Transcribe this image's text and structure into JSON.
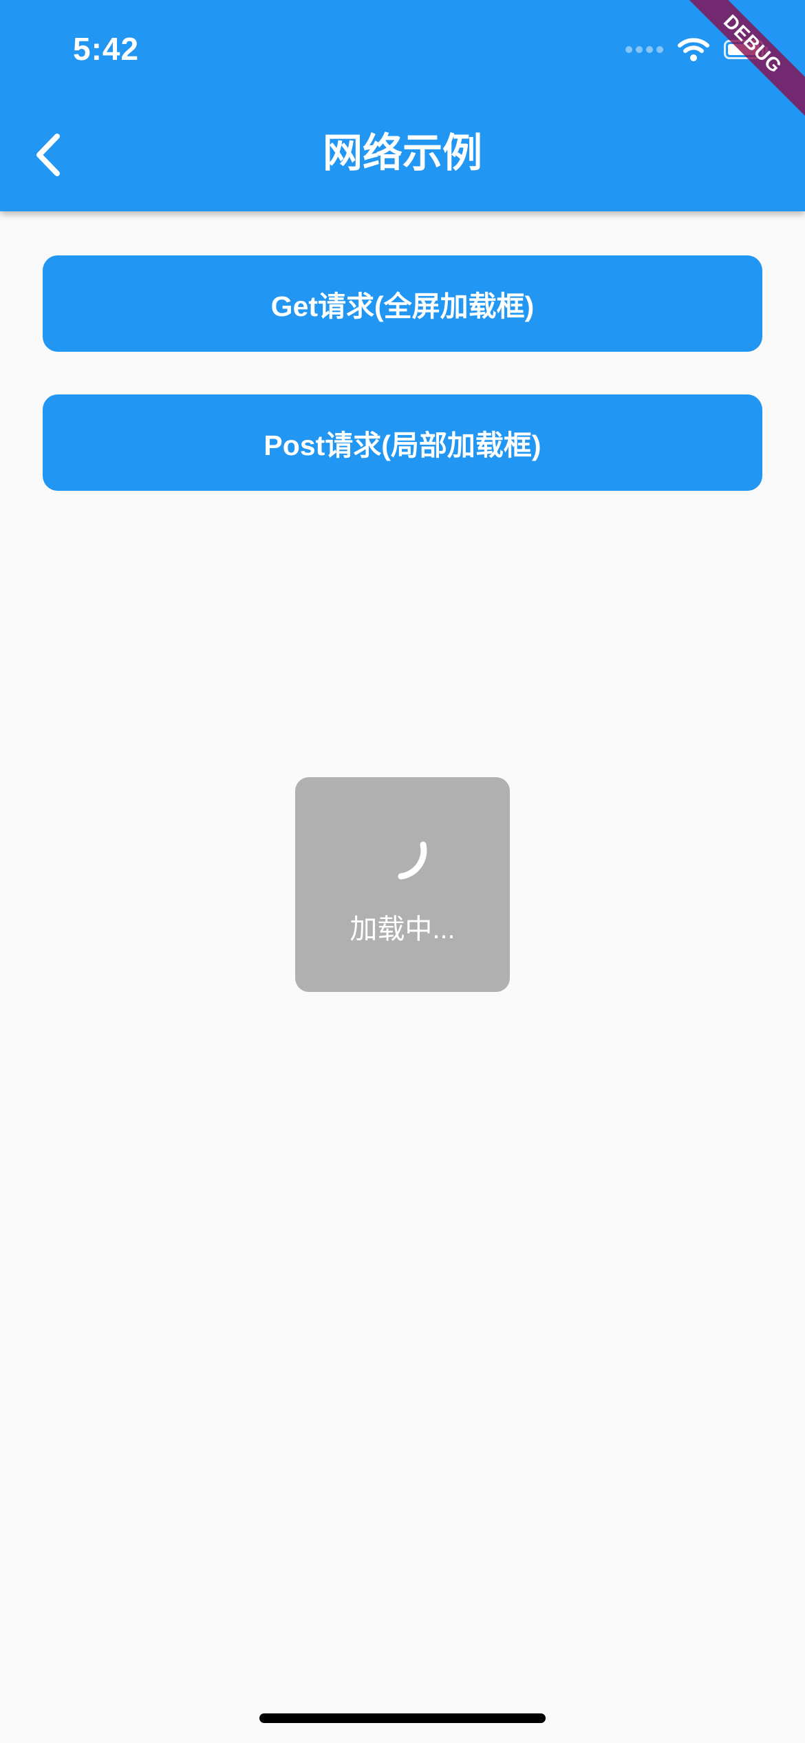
{
  "status_bar": {
    "time": "5:42"
  },
  "app_bar": {
    "title": "网络示例",
    "back_icon": "chevron-left-icon",
    "background_color": "#2196f3"
  },
  "debug_banner": {
    "label": "DEBUG",
    "color": "#880e4f"
  },
  "buttons": [
    {
      "label": "Get请求(全屏加载框)"
    },
    {
      "label": "Post请求(局部加载框)"
    }
  ],
  "loading_dialog": {
    "text": "加载中...",
    "icon": "spinner-icon"
  },
  "colors": {
    "primary": "#2196f3",
    "page_background": "#fafafa",
    "dialog_background": "#b0b0b0"
  }
}
